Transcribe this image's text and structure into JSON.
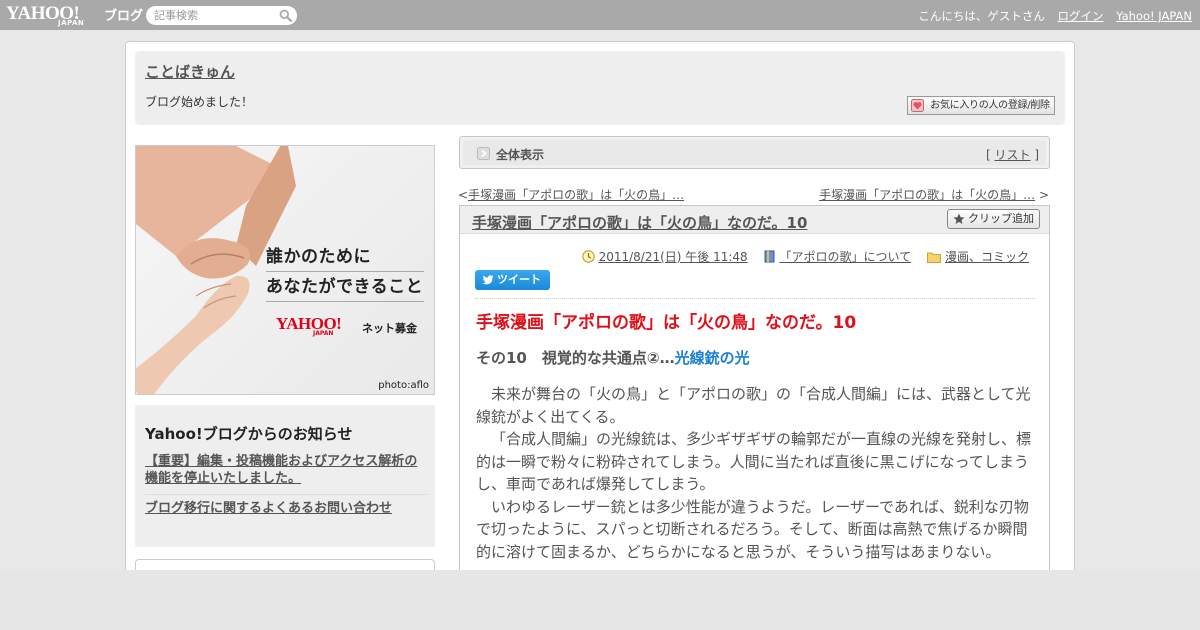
{
  "topbar": {
    "logo_text": "YAHOO!",
    "logo_sub": "JAPAN",
    "logo_blog": "ブログ",
    "search_placeholder": "記事検索",
    "greeting": "こんにちは、ゲストさん",
    "login_label": "ログイン",
    "yahoo_japan_label": "Yahoo! JAPAN"
  },
  "blog": {
    "title": "ことばきゅん",
    "description": "ブログ始めました！",
    "favorite_button": "お気に入りの人の登録/削除"
  },
  "banner": {
    "line1": "誰かのために",
    "line2": "あなたができること",
    "logo_text": "YAHOO!",
    "logo_sub": "JAPAN",
    "service_label": "ネット募金",
    "photo_credit": "photo:aflo"
  },
  "notice": {
    "title": "Yahoo!ブログからのお知らせ",
    "link1": "【重要】編集・投稿機能およびアクセス解析の機能を停止いたしました。",
    "link2": "ブログ移行に関するよくあるお問い合わせ"
  },
  "listbar": {
    "title": "全体表示",
    "bracket_open": "[",
    "list_label": "リスト",
    "bracket_close": "]"
  },
  "pager": {
    "prev_arrow": "<",
    "prev_label": "手塚漫画「アポロの歌」は「火の鳥」…",
    "next_label": "手塚漫画「アポロの歌」は「火の鳥」…",
    "next_arrow": ">"
  },
  "article": {
    "title": "手塚漫画「アポロの歌」は「火の鳥」なのだ。10",
    "clip_button": "クリップ追加",
    "date": "2011/8/21(日) 午後 11:48",
    "book_link": "「アポロの歌」について",
    "category_link": "漫画、コミック",
    "tweet_label": "ツイート",
    "heading": "手塚漫画「アポロの歌」は「火の鳥」なのだ。10",
    "subheading_prefix": "その10　視覚的な共通点②…",
    "subheading_highlight": "光線銃の光",
    "paragraphs": [
      "未来が舞台の「火の鳥」と「アポロの歌」の「合成人間編」には、武器として光線銃がよく出てくる。",
      "「合成人間編」の光線銃は、多少ギザギザの輪郭だが一直線の光線を発射し、標的は一瞬で粉々に粉砕されてしまう。人間に当たれば直後に黒こげになってしまうし、車両であれば爆発してしまう。",
      "いわゆるレーザー銃とは多少性能が違うようだ。レーザーであれば、鋭利な刃物で切ったように、スパっと切断されるだろう。そして、断面は高熱で焦げるか瞬間的に溶けて固まるか、どちらかになると思うが、そういう描写はあまりない。"
    ]
  }
}
